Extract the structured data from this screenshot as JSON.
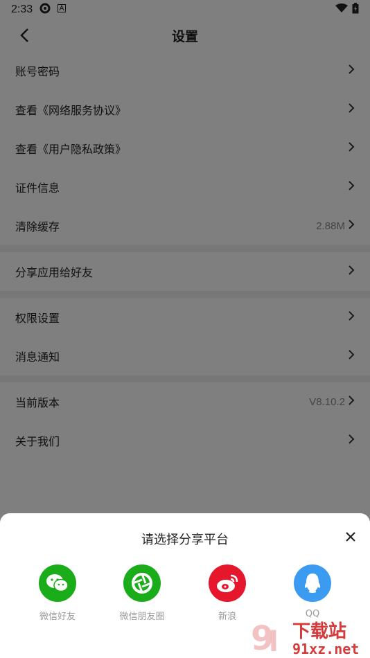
{
  "status_bar": {
    "time": "2:33"
  },
  "nav": {
    "title": "设置"
  },
  "settings": {
    "group1": [
      {
        "label": "账号密码",
        "value": ""
      },
      {
        "label": "查看《网络服务协议》",
        "value": ""
      },
      {
        "label": "查看《用户隐私政策》",
        "value": ""
      },
      {
        "label": "证件信息",
        "value": ""
      },
      {
        "label": "清除缓存",
        "value": "2.88M"
      }
    ],
    "group2": [
      {
        "label": "分享应用给好友",
        "value": ""
      }
    ],
    "group3": [
      {
        "label": "权限设置",
        "value": ""
      },
      {
        "label": "消息通知",
        "value": ""
      }
    ],
    "group4": [
      {
        "label": "当前版本",
        "value": "V8.10.2"
      },
      {
        "label": "关于我们",
        "value": ""
      }
    ]
  },
  "share_sheet": {
    "title": "请选择分享平台",
    "platforms": [
      {
        "label": "微信好友",
        "icon": "wechat-icon",
        "color": "#1aad19"
      },
      {
        "label": "微信朋友圈",
        "icon": "moments-icon",
        "color": "#1aad19"
      },
      {
        "label": "新浪",
        "icon": "weibo-icon",
        "color": "#e6162d"
      },
      {
        "label": "QQ",
        "icon": "qq-icon",
        "color": "#3a9bf0"
      }
    ]
  },
  "watermark": {
    "text": "下载站",
    "site": "91xz.net"
  }
}
